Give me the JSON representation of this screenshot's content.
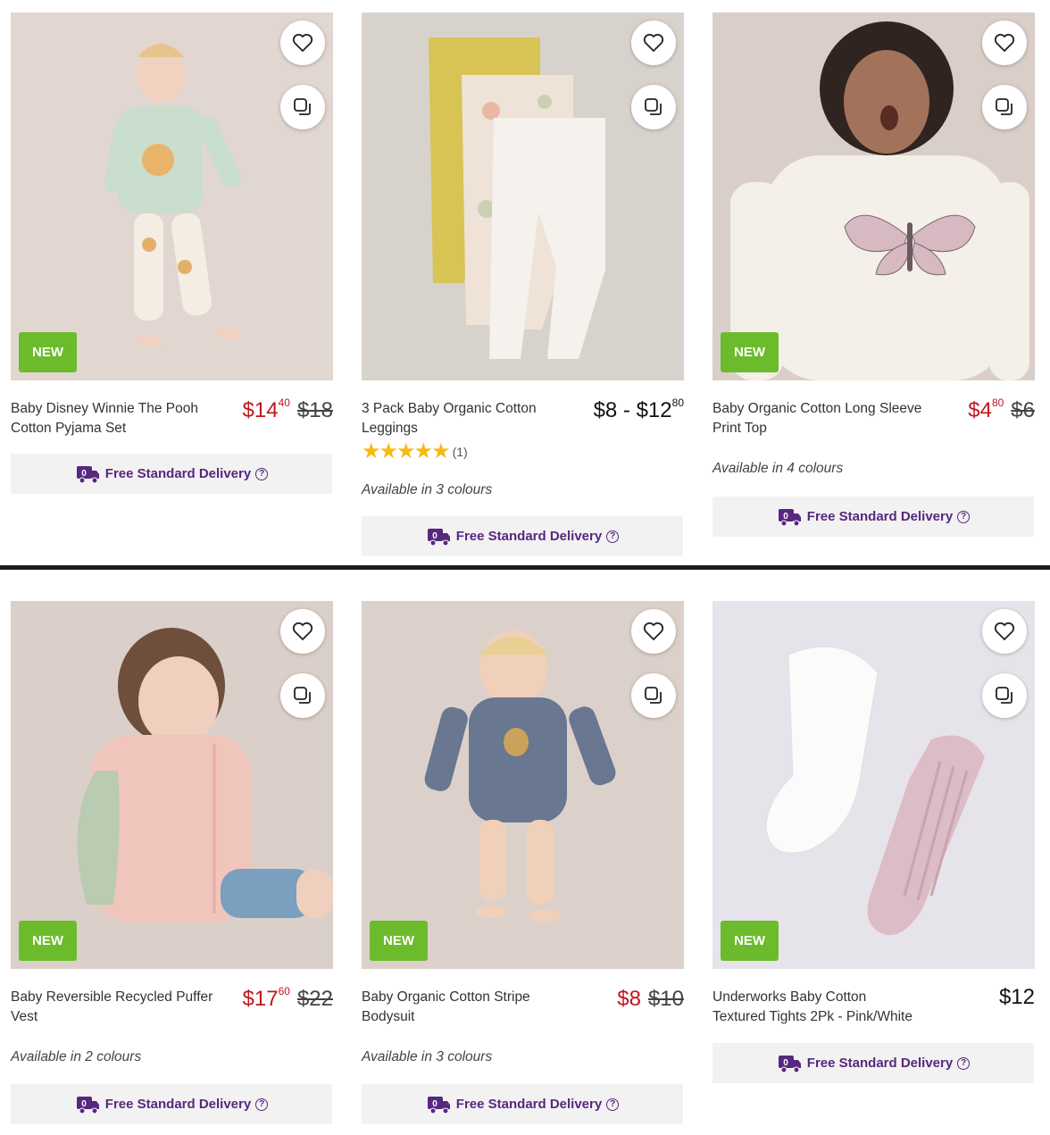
{
  "colors": {
    "sale_price": "#c0161c",
    "new_badge": "#6cbb2c",
    "delivery_text": "#58277f",
    "rating_star": "#f6bb12"
  },
  "products": [
    {
      "name": "Baby Disney Winnie The Pooh Cotton Pyjama Set",
      "badge": "NEW",
      "price_dollars": "$14",
      "price_cents": "40",
      "was_price": "$18",
      "colours": "",
      "delivery": "Free Standard Delivery"
    },
    {
      "name": "3 Pack Baby Organic Cotton Leggings",
      "badge": "",
      "price_dollars": "$8 - $12",
      "price_cents": "80",
      "was_price": "",
      "rating_stars": 5,
      "rating_count": "(1)",
      "colours": "Available in 3 colours",
      "delivery": "Free Standard Delivery"
    },
    {
      "name": "Baby Organic Cotton Long Sleeve Print Top",
      "badge": "NEW",
      "price_dollars": "$4",
      "price_cents": "80",
      "was_price": "$6",
      "colours": "Available in 4 colours",
      "delivery": "Free Standard Delivery"
    },
    {
      "name": "Baby Reversible Recycled Puffer Vest",
      "badge": "NEW",
      "price_dollars": "$17",
      "price_cents": "60",
      "was_price": "$22",
      "colours": "Available in 2 colours",
      "delivery": "Free Standard Delivery"
    },
    {
      "name": "Baby Organic Cotton Stripe Bodysuit",
      "badge": "NEW",
      "price_dollars": "$8",
      "price_cents": "",
      "was_price": "$10",
      "colours": "Available in 3 colours",
      "delivery": "Free Standard Delivery"
    },
    {
      "name": "Underworks Baby Cotton Textured Tights 2Pk - Pink/White",
      "badge": "NEW",
      "price_dollars": "$12",
      "price_cents": "",
      "was_price": "",
      "colours": "",
      "delivery": "Free Standard Delivery"
    }
  ],
  "icons": {
    "favourite": "heart-icon",
    "compare": "compare-icon",
    "delivery": "delivery-truck-icon",
    "help": "help-circle-icon"
  }
}
